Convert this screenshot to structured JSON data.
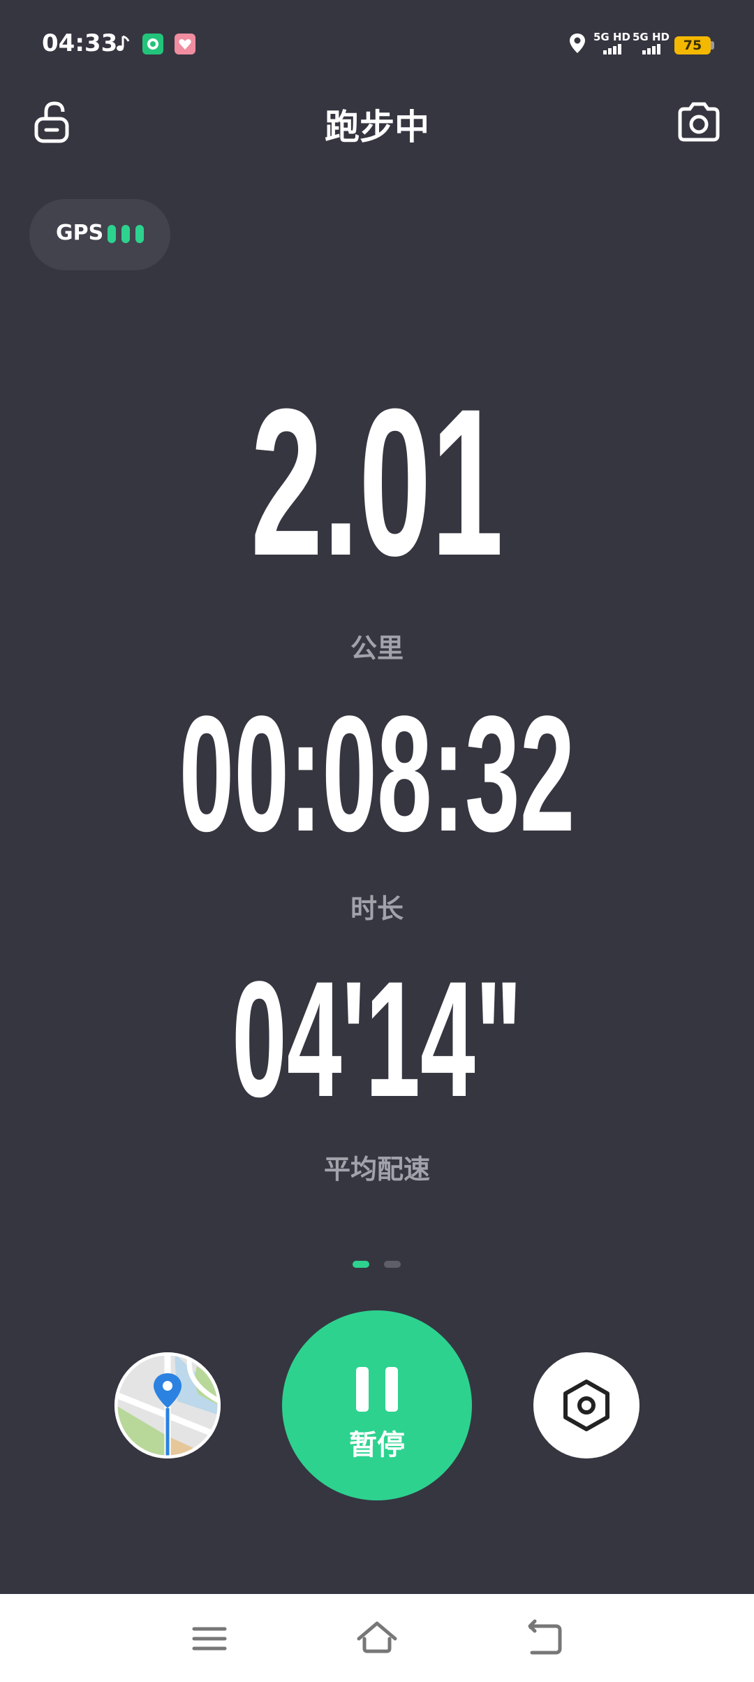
{
  "status_bar": {
    "time": "04:33",
    "signal_1": "5G HD",
    "signal_2": "5G HD",
    "battery": "75"
  },
  "header": {
    "title": "跑步中"
  },
  "gps": {
    "label": "GPS",
    "signal_level": "3/3"
  },
  "metrics": {
    "distance": {
      "value": "2.01",
      "label": "公里"
    },
    "duration": {
      "value": "00:08:32",
      "label": "时长"
    },
    "pace": {
      "value": "04'14\"",
      "label": "平均配速"
    }
  },
  "pager": {
    "pages": 2,
    "current": 1
  },
  "controls": {
    "pause_label": "暂停"
  },
  "colors": {
    "background": "#363641",
    "accent": "#2dd28f",
    "label_gray": "#a2a2aa",
    "battery": "#f5b800"
  },
  "icons": {
    "unlock": "unlock-icon",
    "camera": "camera-icon",
    "map": "map-icon",
    "settings": "hexagon-settings-icon",
    "pause": "pause-icon"
  }
}
